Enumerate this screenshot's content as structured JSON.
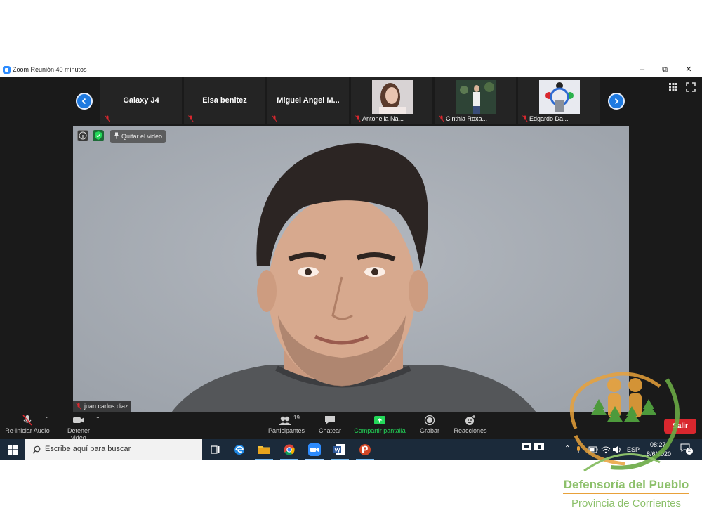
{
  "window": {
    "title": "Zoom Reunión 40 minutos"
  },
  "strip": {
    "tiles": [
      {
        "name": "Galaxy J4"
      },
      {
        "name": "Elsa benitez"
      },
      {
        "name": "Miguel  Angel  M..."
      },
      {
        "name": "Antonella Na..."
      },
      {
        "name": "Cinthia Roxa..."
      },
      {
        "name": "Edgardo Da..."
      }
    ]
  },
  "video": {
    "pin_label": "Quitar el video",
    "speaker_name": "juan carlos diaz"
  },
  "toolbar": {
    "audio_label": "Re-Iniciar Audio",
    "video_label": "Detener video",
    "participants_label": "Participantes",
    "participants_count": "19",
    "chat_label": "Chatear",
    "share_label": "Compartir pantalla",
    "record_label": "Grabar",
    "reactions_label": "Reacciones",
    "leave_label": "Salir"
  },
  "taskbar": {
    "search_placeholder": "Escribe aquí para buscar",
    "language": "ESP",
    "time": "08:27",
    "date": "8/6/2020",
    "notifications": "2"
  },
  "logo": {
    "line1": "Defensoría del Pueblo",
    "line2": "Provincia de Corrientes"
  },
  "colors": {
    "zoom_blue": "#2d8cff",
    "share_green": "#23d959",
    "leave_red": "#d9272e",
    "logo_green": "#8cc06a",
    "logo_orange": "#e8a13a"
  }
}
